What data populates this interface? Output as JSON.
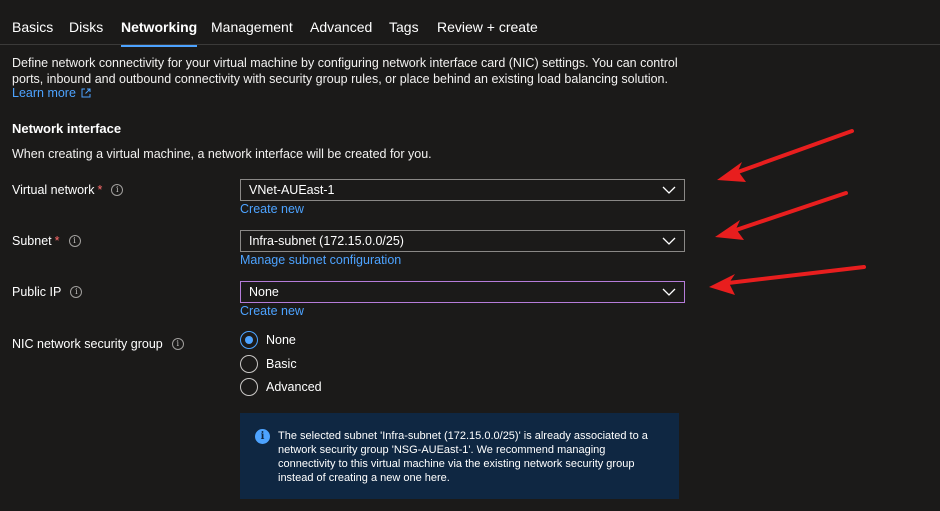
{
  "tabs": [
    {
      "label": "Basics"
    },
    {
      "label": "Disks"
    },
    {
      "label": "Networking",
      "active": true
    },
    {
      "label": "Management"
    },
    {
      "label": "Advanced"
    },
    {
      "label": "Tags"
    },
    {
      "label": "Review + create"
    }
  ],
  "description": "Define network connectivity for your virtual machine by configuring network interface card (NIC) settings. You can control ports, inbound and outbound connectivity with security group rules, or place behind an existing load balancing solution.",
  "learn_more": "Learn more",
  "network_interface": {
    "title": "Network interface",
    "subtitle": "When creating a virtual machine, a network interface will be created for you."
  },
  "fields": {
    "virtual_network": {
      "label": "Virtual network",
      "required": "*",
      "value": "VNet-AUEast-1",
      "link": "Create new"
    },
    "subnet": {
      "label": "Subnet",
      "required": "*",
      "value": "Infra-subnet (172.15.0.0/25)",
      "link": "Manage subnet configuration"
    },
    "public_ip": {
      "label": "Public IP",
      "value": "None",
      "link": "Create new"
    },
    "nic_nsg": {
      "label": "NIC network security group",
      "options": [
        "None",
        "Basic",
        "Advanced"
      ],
      "selected": "None"
    }
  },
  "info_box": {
    "text": "The selected subnet 'Infra-subnet (172.15.0.0/25)' is already associated to a network security group 'NSG-AUEast-1'. We recommend managing connectivity to this virtual machine via the existing network security group instead of creating a new one here."
  },
  "colors": {
    "background": "#1b1a19",
    "accent": "#4da3ff",
    "required": "#ff6b6b",
    "annotation_arrow": "#e81e1e",
    "info_box_bg": "#0f2742"
  },
  "icons": [
    "external-link-icon",
    "info-icon",
    "chevron-down-icon",
    "info-circle-icon",
    "red-arrow-annotation"
  ]
}
